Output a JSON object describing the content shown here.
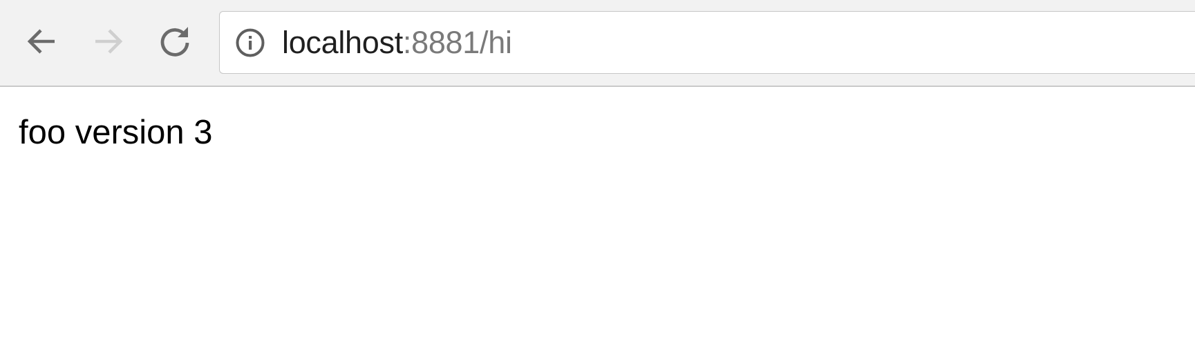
{
  "toolbar": {
    "back_icon": "back-arrow-icon",
    "forward_icon": "forward-arrow-icon",
    "reload_icon": "reload-icon",
    "colors": {
      "background": "#f2f2f2",
      "icon_active": "#6b6b6b",
      "icon_disabled": "#cfcfcf"
    }
  },
  "address_bar": {
    "info_icon": "info-icon",
    "host": "localhost",
    "rest": ":8881/hi",
    "colors": {
      "host": "#1f1f1f",
      "rest": "#7a7a7a"
    }
  },
  "page": {
    "text": "foo version 3"
  }
}
